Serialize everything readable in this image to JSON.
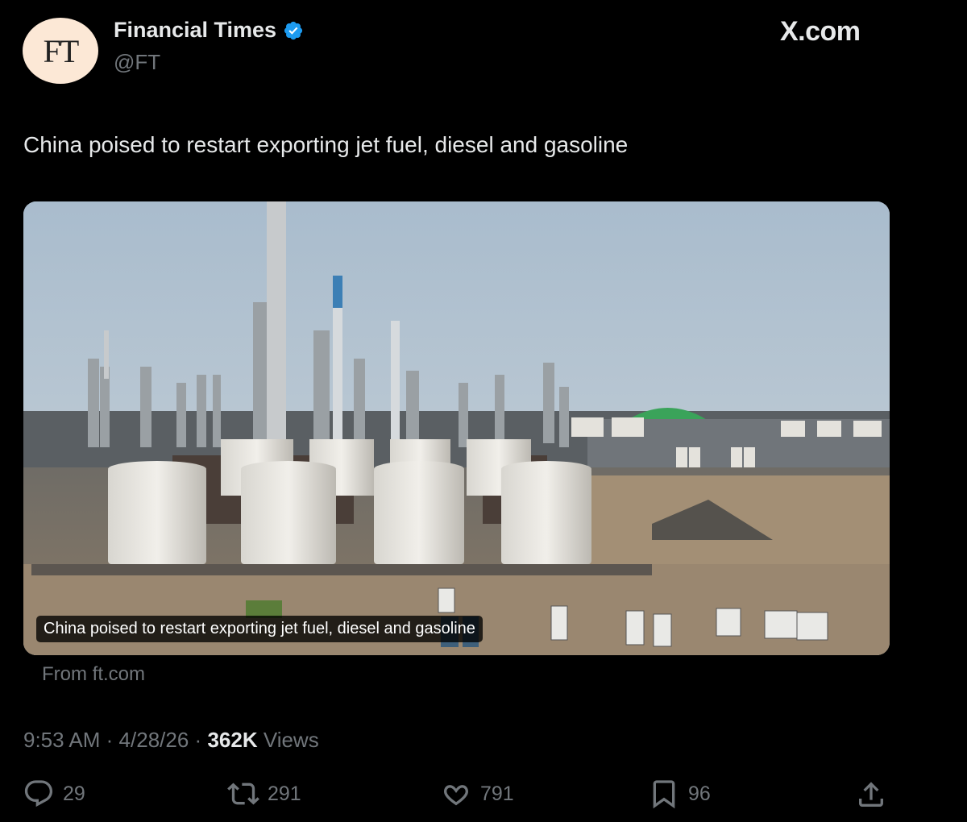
{
  "author": {
    "avatar_text": "FT",
    "name": "Financial Times",
    "handle": "@FT",
    "verified": true
  },
  "brand": "X.com",
  "tweet": {
    "text": "China poised to restart exporting jet fuel, diesel and gasoline"
  },
  "card": {
    "caption": "China poised to restart exporting jet fuel, diesel and gasoline",
    "source": "From ft.com",
    "image_subject": "oil refinery with storage tanks and buses"
  },
  "meta": {
    "time": "9:53 AM",
    "date": "4/28/26",
    "views_count": "362K",
    "views_label": "Views",
    "separator": "·"
  },
  "actions": {
    "replies": "29",
    "reposts": "291",
    "likes": "791",
    "bookmarks": "96"
  },
  "colors": {
    "background": "#000000",
    "text": "#e7e9ea",
    "muted": "#71767b",
    "verified": "#1d9bf0",
    "avatar_bg": "#fce8d6"
  }
}
